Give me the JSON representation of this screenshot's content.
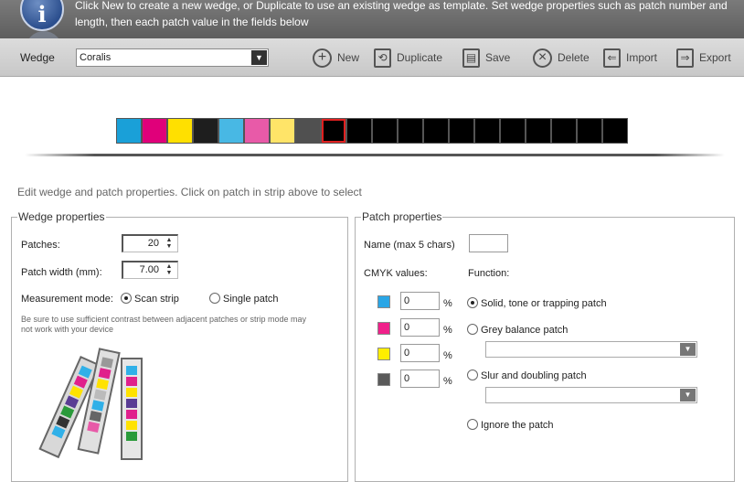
{
  "header": {
    "text": "Click New to create a new wedge, or Duplicate to use an existing wedge as template. Set wedge properties such as patch number and length, then each patch value in the fields below"
  },
  "toolbar": {
    "wedge_label": "Wedge",
    "wedge_value": "Coralis",
    "new_label": "New",
    "duplicate_label": "Duplicate",
    "save_label": "Save",
    "delete_label": "Delete",
    "import_label": "Import",
    "export_label": "Export"
  },
  "strip": {
    "patches": [
      "#1aa0d8",
      "#e0007a",
      "#ffe000",
      "#1e1e1e",
      "#48b8e4",
      "#e85aa8",
      "#ffe468",
      "#505050",
      "#000000",
      "#000000",
      "#000000",
      "#000000",
      "#000000",
      "#000000",
      "#000000",
      "#000000",
      "#000000",
      "#000000",
      "#000000",
      "#000000"
    ],
    "selected_index": 8
  },
  "hint": "Edit wedge and patch properties.  Click on patch in strip above to select",
  "wedge_properties": {
    "legend": "Wedge properties",
    "patches_label": "Patches:",
    "patches_value": "20",
    "width_label": "Patch width (mm):",
    "width_value": "7.00",
    "mode_label": "Measurement mode:",
    "mode_scan": "Scan strip",
    "mode_single": "Single patch",
    "note": "Be sure to use sufficient contrast between adjacent patches or strip mode may not work with your device"
  },
  "patch_properties": {
    "legend": "Patch properties",
    "name_label": "Name (max 5 chars)",
    "name_value": "",
    "cmyk_label": "CMYK values:",
    "function_label": "Function:",
    "cmyk": [
      {
        "color": "#2aa6e6",
        "value": "0",
        "unit": "%"
      },
      {
        "color": "#f0208a",
        "value": "0",
        "unit": "%"
      },
      {
        "color": "#ffee00",
        "value": "0",
        "unit": "%"
      },
      {
        "color": "#5a5a5a",
        "value": "0",
        "unit": "%"
      }
    ],
    "func_solid": "Solid, tone or trapping patch",
    "func_grey": "Grey balance patch",
    "func_slur": "Slur and doubling patch",
    "func_ignore": "Ignore the patch"
  }
}
